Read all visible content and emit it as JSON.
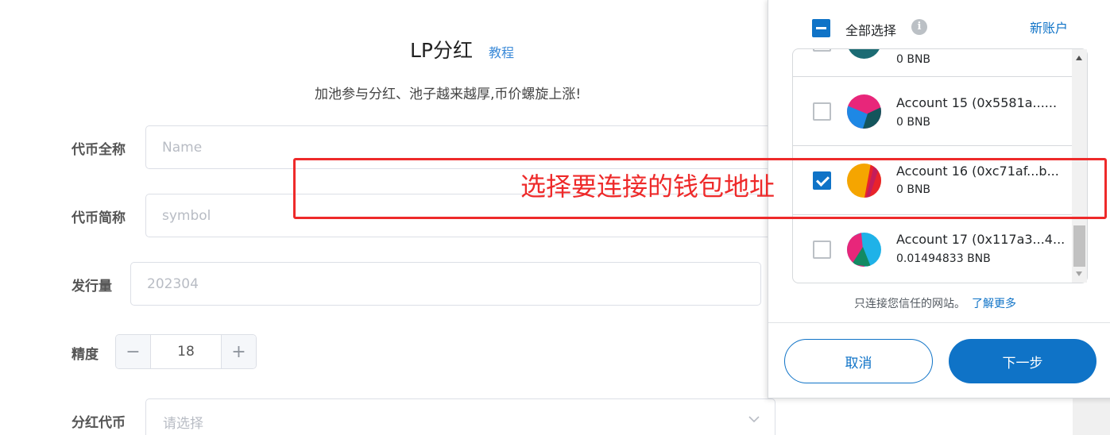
{
  "page": {
    "title": "LP分红",
    "tutorial_link": "教程",
    "subtitle": "加池参与分红、池子越来越厚,币价螺旋上涨!"
  },
  "form": {
    "token_name": {
      "label": "代币全称",
      "placeholder": "Name",
      "value": ""
    },
    "token_symbol": {
      "label": "代币简称",
      "placeholder": "symbol",
      "value": ""
    },
    "supply": {
      "label": "发行量",
      "placeholder": "202304",
      "value": ""
    },
    "decimals": {
      "label": "精度",
      "value": "18",
      "minus": "−",
      "plus": "+"
    },
    "dividend_token": {
      "label": "分红代币",
      "placeholder": "请选择"
    }
  },
  "wallet": {
    "select_all_label": "全部选择",
    "info_icon": "info-icon",
    "new_account_link": "新账户",
    "accounts": [
      {
        "name": "",
        "balance": "0 BNB",
        "checked": false,
        "avatar_colors": [
          "#1b6b73",
          "#e02b6e"
        ]
      },
      {
        "name": "Account 15 (0x5581a......",
        "balance": "0 BNB",
        "checked": false,
        "avatar_colors": [
          "#e8267a",
          "#1e88e5",
          "#14555c"
        ]
      },
      {
        "name": "Account 16 (0xc71af...b...",
        "balance": "0 BNB",
        "checked": true,
        "avatar_colors": [
          "#f5a500",
          "#e8232c"
        ]
      },
      {
        "name": "Account 17 (0x117a3...4...",
        "balance": "0.01494833 BNB",
        "checked": false,
        "avatar_colors": [
          "#1fb2e8",
          "#e8267a",
          "#138a63"
        ]
      }
    ],
    "trust_note": "只连接您信任的网站。",
    "learn_more": "了解更多",
    "cancel_button": "取消",
    "next_button": "下一步",
    "accent_color": "#0f73c7"
  },
  "annotation": {
    "text": "选择要连接的钱包地址",
    "color": "#ee2a2a"
  }
}
